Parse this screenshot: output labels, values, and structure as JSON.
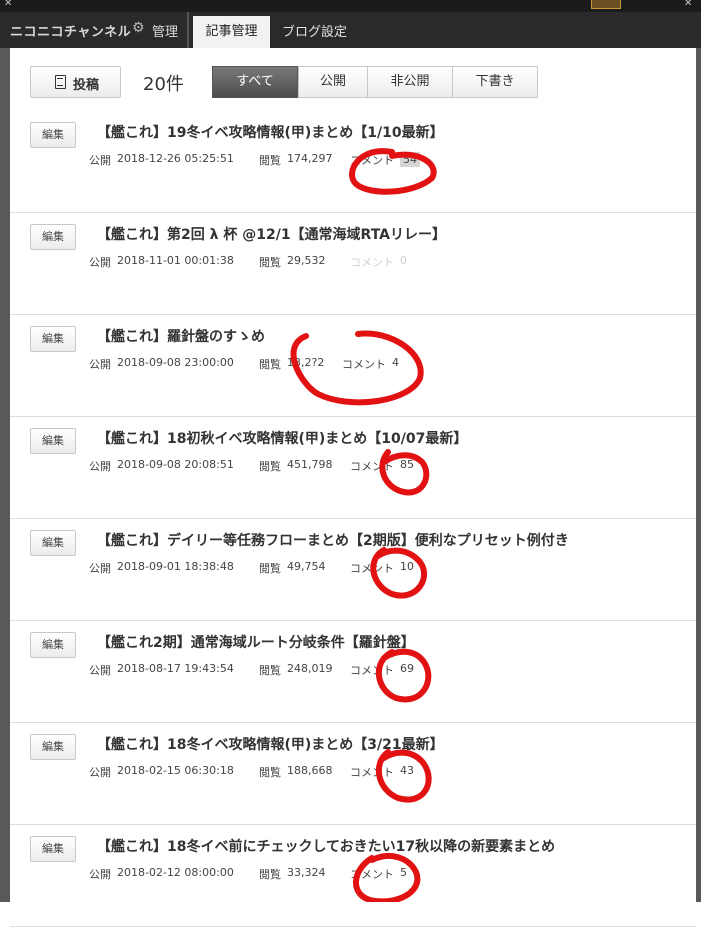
{
  "header": {
    "brand": "ニコニコチャンネル",
    "manage": "管理",
    "tabs": [
      {
        "label": "記事管理",
        "active": true
      },
      {
        "label": "ブログ設定",
        "active": false
      }
    ]
  },
  "toolbar": {
    "post_label": "投稿",
    "count": "20件",
    "filters": [
      "すべて",
      "公開",
      "非公開",
      "下書き"
    ],
    "active_filter": "すべて"
  },
  "edit_label": "編集",
  "colors": {
    "annotation": "#e31212",
    "active_filter_bg": "#5a5a5a"
  },
  "articles": [
    {
      "title": "【艦これ】19冬イベ攻略情報(甲)まとめ【1/10最新】",
      "status": "公開",
      "date": "2018-12-26 05:25:51",
      "views_label": "閲覧",
      "views": "174,297",
      "comment_label": "コメント",
      "comments": "54",
      "highlighted": true
    },
    {
      "title": "【艦これ】第2回 λ 杯 @12/1【通常海域RTAリレー】",
      "status": "公開",
      "date": "2018-11-01 00:01:38",
      "views_label": "閲覧",
      "views": "29,532",
      "comment_label": "コメント",
      "comments": "0",
      "faint": true
    },
    {
      "title": "【艦これ】羅針盤のすゝめ",
      "status": "公開",
      "date": "2018-09-08 23:00:00",
      "views_label": "閲覧",
      "views": "13,2?2",
      "comment_label": "コメント",
      "comments": "4"
    },
    {
      "title": "【艦これ】18初秋イベ攻略情報(甲)まとめ【10/07最新】",
      "status": "公開",
      "date": "2018-09-08 20:08:51",
      "views_label": "閲覧",
      "views": "451,798",
      "comment_label": "コメント",
      "comments": "85"
    },
    {
      "title": "【艦これ】デイリー等任務フローまとめ【2期版】便利なプリセット例付き",
      "status": "公開",
      "date": "2018-09-01 18:38:48",
      "views_label": "閲覧",
      "views": "49,754",
      "comment_label": "コメント",
      "comments": "10"
    },
    {
      "title": "【艦これ2期】通常海域ルート分岐条件【羅針盤】",
      "status": "公開",
      "date": "2018-08-17 19:43:54",
      "views_label": "閲覧",
      "views": "248,019",
      "comment_label": "コメント",
      "comments": "69"
    },
    {
      "title": "【艦これ】18冬イベ攻略情報(甲)まとめ【3/21最新】",
      "status": "公開",
      "date": "2018-02-15 06:30:18",
      "views_label": "閲覧",
      "views": "188,668",
      "comment_label": "コメント",
      "comments": "43"
    },
    {
      "title": "【艦これ】18冬イベ前にチェックしておきたい17秋以降の新要素まとめ",
      "status": "公開",
      "date": "2018-02-12 08:00:00",
      "views_label": "閲覧",
      "views": "33,324",
      "comment_label": "コメント",
      "comments": "5"
    }
  ]
}
